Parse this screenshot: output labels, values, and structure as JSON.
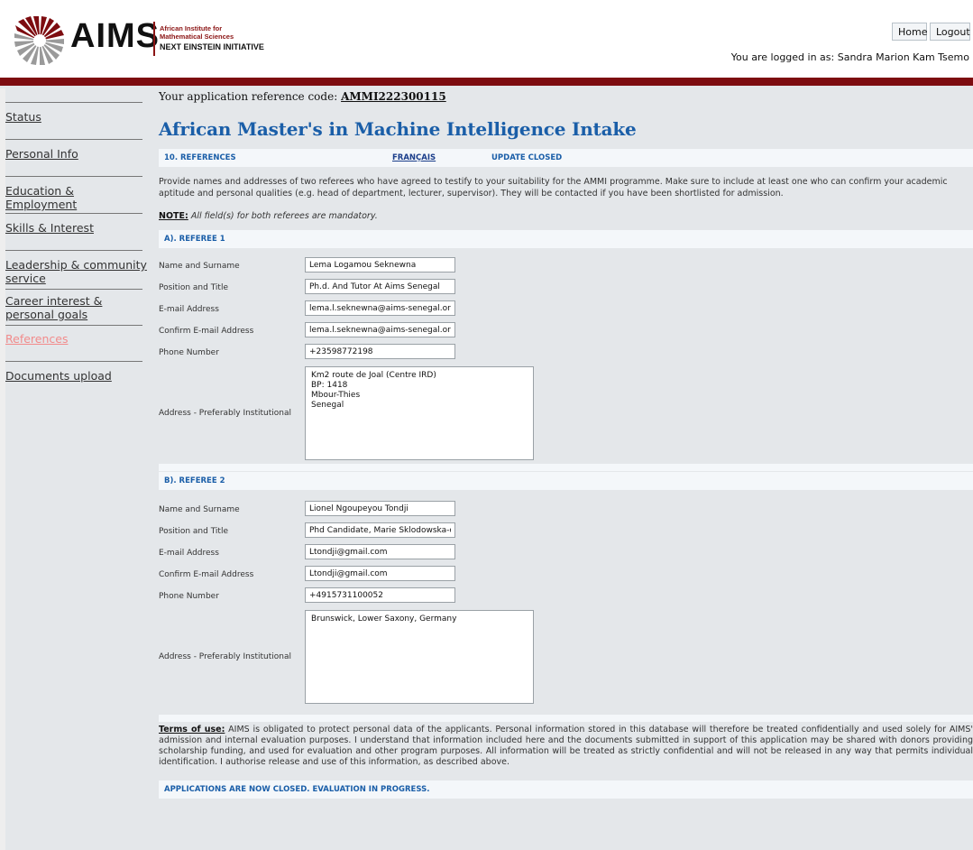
{
  "header": {
    "logo_word": "AIMS",
    "logo_line1": "African Institute for",
    "logo_line2": "Mathematical Sciences",
    "logo_line3": "NEXT EINSTEIN INITIATIVE",
    "home_label": "Home",
    "logout_label": "Logout",
    "logged_in_text": "You are logged in as: Sandra Marion Kam Tsemo"
  },
  "sidebar": {
    "items": [
      {
        "label": "Status"
      },
      {
        "label": "Personal Info"
      },
      {
        "label": "Education & Employment"
      },
      {
        "label": "Skills & Interest"
      },
      {
        "label": "Leadership & community service"
      },
      {
        "label": "Career interest & personal goals"
      },
      {
        "label": "References"
      },
      {
        "label": "Documents upload"
      }
    ],
    "active": "References"
  },
  "main": {
    "ref_code_label": "Your application reference code:",
    "ref_code_value": "AMMI222300115",
    "title": "African Master's in Machine Intelligence Intake",
    "section_label": "10. REFERENCES",
    "francais_label": "FRANÇAIS",
    "update_status": "UPDATE CLOSED",
    "intro": "Provide names and addresses of two referees who have agreed to testify to your suitability for the AMMI programme. Make sure to include at least one who can confirm your academic aptitude and personal qualities (e.g. head of department, lecturer, supervisor). They will be contacted if you have been shortlisted for admission.",
    "note_label": "NOTE:",
    "note_text": "All field(s) for both referees are mandatory.",
    "labels": {
      "name": "Name and Surname",
      "position": "Position and Title",
      "email": "E-mail Address",
      "confirm_email": "Confirm E-mail Address",
      "phone": "Phone Number",
      "address": "Address - Preferably Institutional"
    },
    "referee1": {
      "heading": "A). REFEREE 1",
      "name": "Lema Logamou Seknewna",
      "position": "Ph.d. And Tutor At Aims Senegal",
      "email": "lema.l.seknewna@aims-senegal.org",
      "confirm_email": "lema.l.seknewna@aims-senegal.org",
      "phone": "+23598772198",
      "address": "Km2 route de Joal (Centre IRD)\nBP: 1418\nMbour-Thies\nSenegal"
    },
    "referee2": {
      "heading": "B). REFEREE 2",
      "name": "Lionel Ngoupeyou Tondji",
      "position": "Phd Candidate, Marie Sklodowska-cu",
      "email": "Ltondji@gmail.com",
      "confirm_email": "Ltondji@gmail.com",
      "phone": "+4915731100052",
      "address": "Brunswick, Lower Saxony, Germany"
    },
    "terms_label": "Terms of use:",
    "terms_text": "AIMS is obligated to protect personal data of the applicants. Personal information stored in this database will therefore be treated confidentially and used solely for AIMS' admission and internal evaluation purposes. I understand that information included here and the documents submitted in support of this application may be shared with donors providing scholarship funding, and used for evaluation and other program purposes. All information will be treated as strictly confidential and will not be released in any way that permits individual identification. I authorise release and use of this information, as described above.",
    "closed_message": "APPLICATIONS ARE NOW CLOSED. EVALUATION IN PROGRESS."
  }
}
